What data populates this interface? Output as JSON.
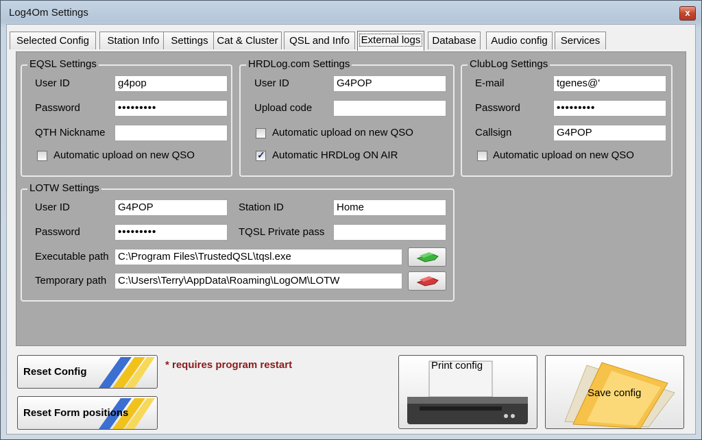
{
  "window": {
    "title": "Log4Om Settings",
    "close_glyph": "x"
  },
  "tabs": [
    {
      "label": "Selected Config"
    },
    {
      "label": "Station Info"
    },
    {
      "label": "Settings"
    },
    {
      "label": "Cat & Cluster"
    },
    {
      "label": "QSL and Info"
    },
    {
      "label": "External logs"
    },
    {
      "label": "Database"
    },
    {
      "label": "Audio config"
    },
    {
      "label": "Services"
    }
  ],
  "active_tab": "External logs",
  "eqsl": {
    "title": "EQSL Settings",
    "user_id_label": "User ID",
    "user_id_value": "g4pop",
    "password_label": "Password",
    "password_value": "•••••••••",
    "qth_label": "QTH Nickname",
    "qth_value": "",
    "auto_upload_label": "Automatic upload on new QSO",
    "auto_upload_checked": false
  },
  "hrdlog": {
    "title": "HRDLog.com Settings",
    "user_id_label": "User ID",
    "user_id_value": "G4POP",
    "upload_code_label": "Upload code",
    "upload_code_value": "",
    "auto_upload_label": "Automatic upload on new QSO",
    "auto_upload_checked": false,
    "on_air_label": "Automatic HRDLog ON AIR",
    "on_air_checked": true
  },
  "clublog": {
    "title": "ClubLog Settings",
    "email_label": "E-mail",
    "email_value": "tgenes@'",
    "password_label": "Password",
    "password_value": "•••••••••",
    "callsign_label": "Callsign",
    "callsign_value": "G4POP",
    "auto_upload_label": "Automatic upload on new QSO",
    "auto_upload_checked": false
  },
  "lotw": {
    "title": "LOTW Settings",
    "user_id_label": "User ID",
    "user_id_value": "G4POP",
    "password_label": "Password",
    "password_value": "•••••••••",
    "station_id_label": "Station ID",
    "station_id_value": "Home",
    "tqsl_pass_label": "TQSL Private pass",
    "tqsl_pass_value": "",
    "exe_path_label": "Executable path",
    "exe_path_value": "C:\\Program Files\\TrustedQSL\\tqsl.exe",
    "temp_path_label": "Temporary path",
    "temp_path_value": "C:\\Users\\Terry\\AppData\\Roaming\\LogOM\\LOTW"
  },
  "footer": {
    "reset_config": "Reset Config",
    "reset_form": "Reset Form positions",
    "restart_note": "* requires program restart",
    "print_config": "Print config",
    "save_config": "Save config"
  },
  "icons": {
    "green_folder": "green-folder-icon",
    "red_folder": "red-folder-icon",
    "printer": "printer-icon",
    "save": "save-folder-icon",
    "stripes": "yellow-stripes-icon"
  },
  "colors": {
    "panel_bg": "#a9a9a9",
    "note_red": "#8b1a1a",
    "green_icon": "#3cb43c",
    "red_icon": "#d43a3a"
  }
}
